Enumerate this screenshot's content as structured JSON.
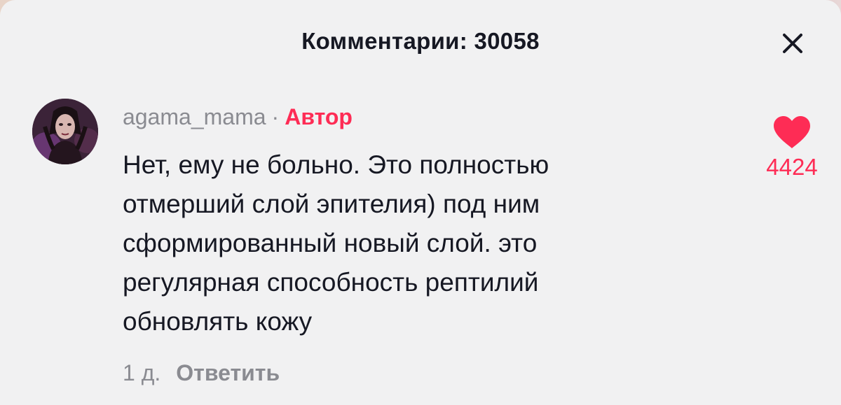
{
  "header": {
    "title": "Комментарии: 30058",
    "close_icon": "close-icon"
  },
  "comment": {
    "avatar_icon": "user-avatar",
    "username": "agama_mama",
    "separator": "·",
    "author_badge": "Автор",
    "text_lines": [
      "Нет, ему не больно. Это полностью",
      "отмерший слой эпителия) под ним",
      "сформированный новый слой. это",
      "регулярная способность рептилий",
      "обновлять кожу"
    ],
    "time": "1 д.",
    "reply_label": "Ответить",
    "like_icon": "heart-icon",
    "like_count": "4424"
  },
  "colors": {
    "accent": "#fe2c55",
    "text_primary": "#161823",
    "text_secondary": "#8a8b91",
    "sheet_background": "#f1f1f2"
  }
}
